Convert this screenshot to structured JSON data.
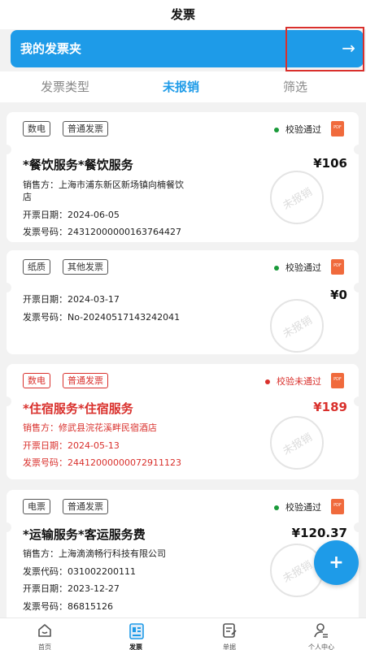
{
  "header": {
    "title": "发票"
  },
  "banner": {
    "title": "我的发票夹",
    "arrow": "→"
  },
  "tabs": [
    {
      "label": "发票类型"
    },
    {
      "label": "未报销"
    },
    {
      "label": "筛选"
    }
  ],
  "invoices": [
    {
      "tags": [
        "数电",
        "普通发票"
      ],
      "status": "校验通过",
      "name": "*餐饮服务*餐饮服务",
      "amount": "¥106",
      "seller_line1": "销售方：上海市浦东新区新场镇向楠餐饮",
      "seller_line2": "店",
      "date": "开票日期：2024-06-05",
      "number": "发票号码：24312000000163764427",
      "stamp": "未报销"
    },
    {
      "tags": [
        "纸质",
        "其他发票"
      ],
      "status": "校验通过",
      "amount": "¥0",
      "date": "开票日期：2024-03-17",
      "number": "发票号码：No-20240517143242041",
      "stamp": "未报销"
    },
    {
      "tags": [
        "数电",
        "普通发票"
      ],
      "status": "校验未通过",
      "name": "*住宿服务*住宿服务",
      "amount": "¥189",
      "seller_line1": "销售方：修武县浣花溪畔民宿酒店",
      "date": "开票日期：2024-05-13",
      "number": "发票号码：24412000000072911123",
      "stamp": "未报销"
    },
    {
      "tags": [
        "电票",
        "普通发票"
      ],
      "status": "校验通过",
      "name": "*运输服务*客运服务费",
      "amount": "¥120.37",
      "seller_line1": "销售方：上海滴滴畅行科技有限公司",
      "code": "发票代码：031002200111",
      "date": "开票日期：2023-12-27",
      "number": "发票号码：86815126",
      "stamp": "未报销"
    }
  ],
  "pdf_label": "PDF",
  "fab": {
    "label": "+"
  },
  "nav": [
    {
      "label": "首页",
      "icon": "home-icon"
    },
    {
      "label": "发票",
      "icon": "invoice-icon"
    },
    {
      "label": "单据",
      "icon": "document-edit-icon"
    },
    {
      "label": "个人中心",
      "icon": "user-icon"
    }
  ],
  "colors": {
    "accent": "#1e9be8",
    "success": "#1a9a3a",
    "error": "#d9302c"
  }
}
